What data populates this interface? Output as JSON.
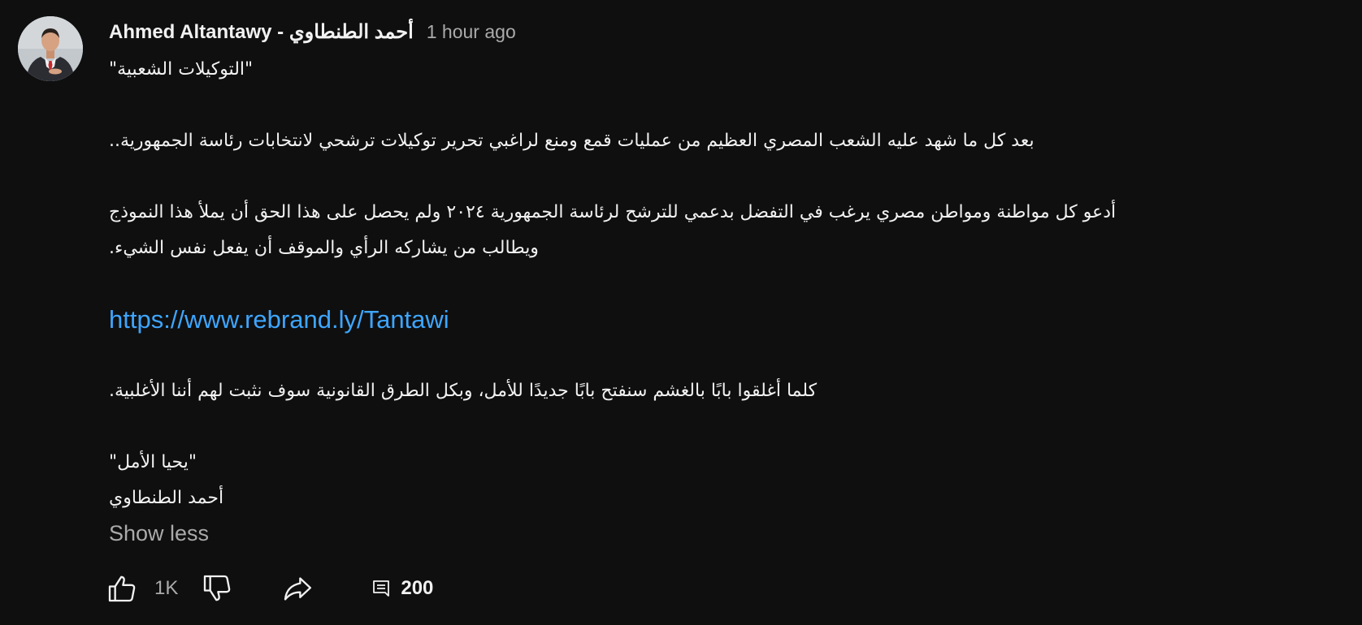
{
  "author": {
    "name": "أحمد الطنطاوي - Ahmed Altantawy",
    "timestamp": "1 hour ago"
  },
  "post": {
    "lines": [
      "\"التوكيلات الشعبية\"",
      "",
      "بعد كل ما شهد عليه الشعب المصري العظيم من عمليات قمع ومنع لراغبي تحرير توكيلات ترشحي لانتخابات رئاسة الجمهورية..",
      "",
      "أدعو كل مواطنة ومواطن مصري يرغب في التفضل بدعمي للترشح لرئاسة الجمهورية ٢٠٢٤ ولم يحصل على هذا الحق أن يملأ هذا النموذج",
      "ويطالب من يشاركه الرأي والموقف أن يفعل نفس الشيء."
    ],
    "link": "https://www.rebrand.ly/Tantawi",
    "lines_after_link": [
      "كلما أغلقوا بابًا بالغشم سنفتح بابًا جديدًا للأمل، وبكل الطرق القانونية سوف نثبت لهم أننا الأغلبية.",
      "",
      "\"يحيا الأمل\"",
      "أحمد الطنطاوي"
    ],
    "show_less_label": "Show less"
  },
  "toolbar": {
    "like_count": "1K",
    "comments_count": "200",
    "icons": [
      "thumb-up-icon",
      "thumb-down-icon",
      "share-icon",
      "comment-icon"
    ]
  },
  "colors": {
    "background": "#0f0f0f",
    "text": "#f1f1f1",
    "secondary_text": "#aaaaaa",
    "link": "#3ea6ff"
  }
}
